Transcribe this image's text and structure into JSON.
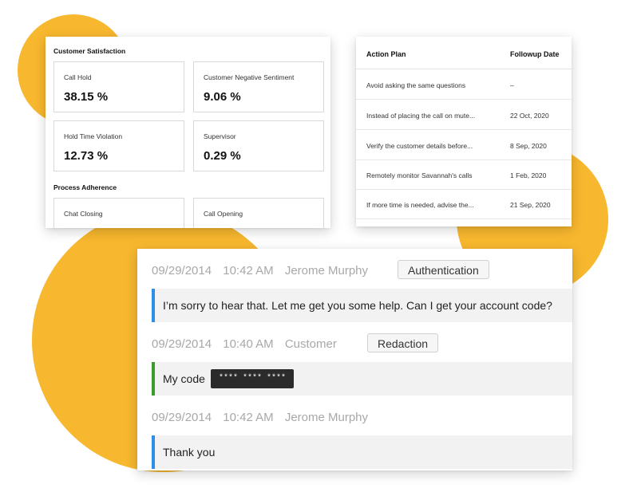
{
  "colors": {
    "accent": "#F7B72E",
    "agent_bar": "#2D8FE8",
    "customer_bar": "#3C9B2D"
  },
  "metrics": {
    "section1": "Customer Satisfaction",
    "section2": "Process Adherence",
    "tiles": [
      {
        "label": "Call Hold",
        "value": "38.15 %"
      },
      {
        "label": "Customer Negative Sentiment",
        "value": "9.06 %"
      },
      {
        "label": "Hold Time Violation",
        "value": "12.73 %"
      },
      {
        "label": "Supervisor",
        "value": "0.29 %"
      },
      {
        "label": "Chat Closing"
      },
      {
        "label": "Call Opening"
      }
    ]
  },
  "action_plan": {
    "header_action": "Action Plan",
    "header_date": "Followup Date",
    "rows": [
      {
        "action": "Avoid asking the same questions",
        "date": "–"
      },
      {
        "action": "Instead of placing the call on mute...",
        "date": "22 Oct, 2020"
      },
      {
        "action": "Verify the customer details before...",
        "date": "8 Sep, 2020"
      },
      {
        "action": "Remotely monitor Savannah's calls",
        "date": "1 Feb, 2020"
      },
      {
        "action": "If more time is needed, advise the...",
        "date": "21 Sep, 2020"
      }
    ]
  },
  "transcript": [
    {
      "date": "09/29/2014",
      "time": "10:42 AM",
      "speaker": "Jerome Murphy",
      "tag": "Authentication",
      "message": "I’m sorry to hear that. Let me get you some help. Can I get your account code?"
    },
    {
      "date": "09/29/2014",
      "time": "10:40 AM",
      "speaker": "Customer",
      "tag": "Redaction",
      "message": "My code",
      "redacted": "**** **** ****"
    },
    {
      "date": "09/29/2014",
      "time": "10:42 AM",
      "speaker": "Jerome Murphy",
      "message": "Thank you"
    }
  ]
}
